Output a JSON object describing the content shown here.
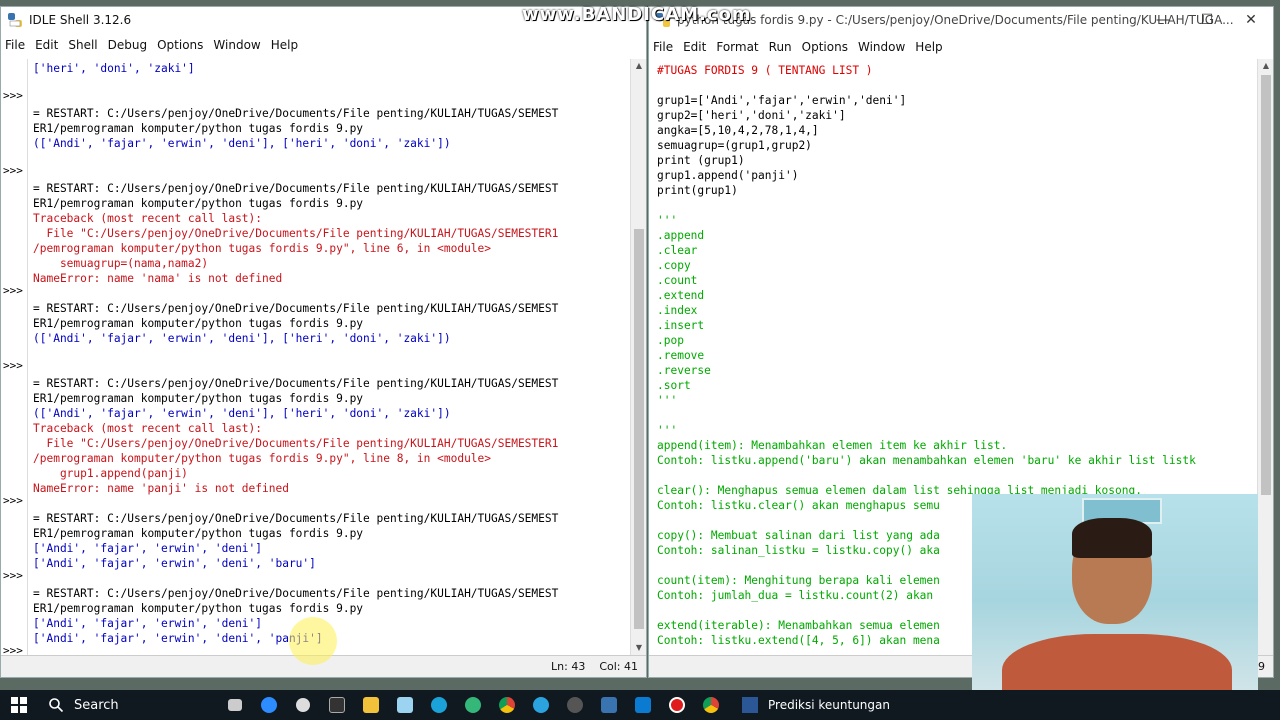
{
  "watermark": "www.BANDICAM.com",
  "shell": {
    "title": "IDLE Shell 3.12.6",
    "menu": [
      "File",
      "Edit",
      "Shell",
      "Debug",
      "Options",
      "Window",
      "Help"
    ],
    "prompts": [
      ">>>",
      ">>>",
      ">>>",
      ">>>",
      ">>>",
      ">>>",
      ">>>"
    ],
    "lines": [
      {
        "text": "['heri', 'doni', 'zaki']",
        "cls": "out"
      },
      {
        "text": "",
        "cls": "out"
      },
      {
        "text": "",
        "cls": "out"
      },
      {
        "text": "= RESTART: C:/Users/penjoy/OneDrive/Documents/File penting/KULIAH/TUGAS/SEMEST",
        "cls": "black"
      },
      {
        "text": "ER1/pemrograman komputer/python tugas fordis 9.py",
        "cls": "black"
      },
      {
        "text": "(['Andi', 'fajar', 'erwin', 'deni'], ['heri', 'doni', 'zaki'])",
        "cls": "out"
      },
      {
        "text": "",
        "cls": "out"
      },
      {
        "text": "",
        "cls": "out"
      },
      {
        "text": "= RESTART: C:/Users/penjoy/OneDrive/Documents/File penting/KULIAH/TUGAS/SEMEST",
        "cls": "black"
      },
      {
        "text": "ER1/pemrograman komputer/python tugas fordis 9.py",
        "cls": "black"
      },
      {
        "text": "Traceback (most recent call last):",
        "cls": "err"
      },
      {
        "text": "  File \"C:/Users/penjoy/OneDrive/Documents/File penting/KULIAH/TUGAS/SEMESTER1",
        "cls": "err"
      },
      {
        "text": "/pemrograman komputer/python tugas fordis 9.py\", line 6, in <module>",
        "cls": "err"
      },
      {
        "text": "    semuagrup=(nama,nama2)",
        "cls": "err"
      },
      {
        "text": "NameError: name 'nama' is not defined",
        "cls": "err"
      },
      {
        "text": "",
        "cls": "out"
      },
      {
        "text": "= RESTART: C:/Users/penjoy/OneDrive/Documents/File penting/KULIAH/TUGAS/SEMEST",
        "cls": "black"
      },
      {
        "text": "ER1/pemrograman komputer/python tugas fordis 9.py",
        "cls": "black"
      },
      {
        "text": "(['Andi', 'fajar', 'erwin', 'deni'], ['heri', 'doni', 'zaki'])",
        "cls": "out"
      },
      {
        "text": "",
        "cls": "out"
      },
      {
        "text": "",
        "cls": "out"
      },
      {
        "text": "= RESTART: C:/Users/penjoy/OneDrive/Documents/File penting/KULIAH/TUGAS/SEMEST",
        "cls": "black"
      },
      {
        "text": "ER1/pemrograman komputer/python tugas fordis 9.py",
        "cls": "black"
      },
      {
        "text": "(['Andi', 'fajar', 'erwin', 'deni'], ['heri', 'doni', 'zaki'])",
        "cls": "out"
      },
      {
        "text": "Traceback (most recent call last):",
        "cls": "err"
      },
      {
        "text": "  File \"C:/Users/penjoy/OneDrive/Documents/File penting/KULIAH/TUGAS/SEMESTER1",
        "cls": "err"
      },
      {
        "text": "/pemrograman komputer/python tugas fordis 9.py\", line 8, in <module>",
        "cls": "err"
      },
      {
        "text": "    grup1.append(panji)",
        "cls": "err"
      },
      {
        "text": "NameError: name 'panji' is not defined",
        "cls": "err"
      },
      {
        "text": "",
        "cls": "out"
      },
      {
        "text": "= RESTART: C:/Users/penjoy/OneDrive/Documents/File penting/KULIAH/TUGAS/SEMEST",
        "cls": "black"
      },
      {
        "text": "ER1/pemrograman komputer/python tugas fordis 9.py",
        "cls": "black"
      },
      {
        "text": "['Andi', 'fajar', 'erwin', 'deni']",
        "cls": "out"
      },
      {
        "text": "['Andi', 'fajar', 'erwin', 'deni', 'baru']",
        "cls": "out"
      },
      {
        "text": "",
        "cls": "out"
      },
      {
        "text": "= RESTART: C:/Users/penjoy/OneDrive/Documents/File penting/KULIAH/TUGAS/SEMEST",
        "cls": "black"
      },
      {
        "text": "ER1/pemrograman komputer/python tugas fordis 9.py",
        "cls": "black"
      },
      {
        "text": "['Andi', 'fajar', 'erwin', 'deni']",
        "cls": "out"
      },
      {
        "text": "['Andi', 'fajar', 'erwin', 'deni', 'panji']",
        "cls": "out"
      }
    ],
    "status": {
      "ln": "Ln: 43",
      "col": "Col: 41"
    }
  },
  "editor": {
    "title": "python tugas fordis 9.py - C:/Users/penjoy/OneDrive/Documents/File penting/KULIAH/TUGA...",
    "menu": [
      "File",
      "Edit",
      "Format",
      "Run",
      "Options",
      "Window",
      "Help"
    ],
    "lines": [
      {
        "text": "#TUGAS FORDIS 9 ( TENTANG LIST )",
        "cls": "cm"
      },
      {
        "text": "",
        "cls": "black"
      },
      {
        "text": "grup1=['Andi','fajar','erwin','deni']",
        "cls": "black"
      },
      {
        "text": "grup2=['heri','doni','zaki']",
        "cls": "black"
      },
      {
        "text": "angka=[5,10,4,2,78,1,4,]",
        "cls": "black"
      },
      {
        "text": "semuagrup=(grup1,grup2)",
        "cls": "black"
      },
      {
        "text": "print (grup1)",
        "cls": "black"
      },
      {
        "text": "grup1.append('panji')",
        "cls": "black"
      },
      {
        "text": "print(grup1)",
        "cls": "black"
      },
      {
        "text": "",
        "cls": "black"
      },
      {
        "text": "'''",
        "cls": "doc"
      },
      {
        "text": ".append",
        "cls": "doc"
      },
      {
        "text": ".clear",
        "cls": "doc"
      },
      {
        "text": ".copy",
        "cls": "doc"
      },
      {
        "text": ".count",
        "cls": "doc"
      },
      {
        "text": ".extend",
        "cls": "doc"
      },
      {
        "text": ".index",
        "cls": "doc"
      },
      {
        "text": ".insert",
        "cls": "doc"
      },
      {
        "text": ".pop",
        "cls": "doc"
      },
      {
        "text": ".remove",
        "cls": "doc"
      },
      {
        "text": ".reverse",
        "cls": "doc"
      },
      {
        "text": ".sort",
        "cls": "doc"
      },
      {
        "text": "'''",
        "cls": "doc"
      },
      {
        "text": "",
        "cls": "doc"
      },
      {
        "text": "'''",
        "cls": "doc"
      },
      {
        "text": "append(item): Menambahkan elemen item ke akhir list.",
        "cls": "doc"
      },
      {
        "text": "Contoh: listku.append('baru') akan menambahkan elemen 'baru' ke akhir list listk",
        "cls": "doc"
      },
      {
        "text": "",
        "cls": "doc"
      },
      {
        "text": "clear(): Menghapus semua elemen dalam list sehingga list menjadi kosong.",
        "cls": "doc"
      },
      {
        "text": "Contoh: listku.clear() akan menghapus semu",
        "cls": "doc"
      },
      {
        "text": "",
        "cls": "doc"
      },
      {
        "text": "copy(): Membuat salinan dari list yang ada",
        "cls": "doc"
      },
      {
        "text": "Contoh: salinan_listku = listku.copy() aka",
        "cls": "doc"
      },
      {
        "text": "",
        "cls": "doc"
      },
      {
        "text": "count(item): Menghitung berapa kali elemen",
        "cls": "doc"
      },
      {
        "text": "Contoh: jumlah_dua = listku.count(2) akan",
        "cls": "doc"
      },
      {
        "text": "",
        "cls": "doc"
      },
      {
        "text": "extend(iterable): Menambahkan semua elemen",
        "cls": "doc"
      },
      {
        "text": "Contoh: listku.extend([4, 5, 6]) akan mena",
        "cls": "doc"
      }
    ],
    "status_col": ": 19"
  },
  "taskbar": {
    "search_label": "Search",
    "app_label": "Prediksi keuntungan"
  }
}
